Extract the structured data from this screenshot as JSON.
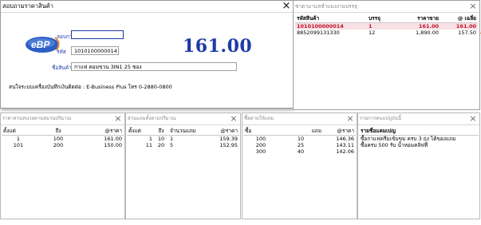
{
  "main_window": {
    "title": "สอบถามราคาสินค้า",
    "close_glyph": "×",
    "barcode_label": "ลอบกาม",
    "barcode_value": "",
    "code_label": "รหัส",
    "code_value": "1010100000014",
    "name_label": "ชื่อสินค้า",
    "name_value": "กาแฟ คอมขวน 3IN1 25 ซอง",
    "price": "161.00",
    "contact_text": "สนใจระบบเครื่องบันทึกเงินติดต่อ : E-Business Plus โทร 0-2880-0800",
    "colors": {
      "price": "#1e3aa8",
      "logo_blue": "#2c5fc4",
      "accent_orange": "#e8842f",
      "selected_row": "#c0122a"
    }
  },
  "barcode_panel": {
    "title": "ชาตามาแลชำแมงงามบรรจุ",
    "close_glyph": "×",
    "headers": [
      "รหัสสินค้า",
      "บรรจุ",
      "ราคาขาย",
      "@ เฉลี่ย"
    ],
    "rows": [
      {
        "code": "1010100000014",
        "pack": "1",
        "price": "161.00",
        "avg": "161.00",
        "selected": true
      },
      {
        "code": "8852099131330",
        "pack": "12",
        "price": "1,890.00",
        "avg": "157.50",
        "selected": false
      }
    ]
  },
  "qty_price_panel": {
    "title": "ราคาสวนหนวยตามสมวนปริมาณ",
    "close_glyph": "×",
    "headers": [
      "ตั้งแต่",
      "ถึง",
      "@ราคา"
    ],
    "rows": [
      {
        "from": "1",
        "to": "100",
        "price": "161.00"
      },
      {
        "from": "101",
        "to": "200",
        "price": "150.00"
      }
    ]
  },
  "free_panel": {
    "title": "ส่วนแถมตั้งตามปริมาณ",
    "close_glyph": "×",
    "headers": [
      "ตั้งแต่",
      "ถึง",
      "จำนวนแถม",
      "@ราคา"
    ],
    "rows": [
      {
        "from": "1",
        "to": "10",
        "qty": "1",
        "price": "159.39"
      },
      {
        "from": "11",
        "to": "20",
        "qty": "5",
        "price": "152.95"
      }
    ]
  },
  "buy_free_panel": {
    "title": "ซื้อตามให้แถม",
    "close_glyph": "×",
    "headers": [
      "ซื้อ",
      "แถม",
      "@ราคา"
    ],
    "rows": [
      {
        "buy": "100",
        "free": "10",
        "price": "146.36"
      },
      {
        "buy": "200",
        "free": "25",
        "price": "143.11"
      },
      {
        "buy": "300",
        "free": "40",
        "price": "142.06"
      }
    ]
  },
  "promo_panel": {
    "title": "รายการคนแปบูบันนี้",
    "close_glyph": "×",
    "header": "รายชื่อแคมเปญ",
    "rows": [
      "ซื้อกาแฟครีมเข้มขม ครบ 3 ถุง ได้ของแถม",
      "ซื้อครบ 500 รับ น้ำหอมคลิฟที"
    ]
  }
}
